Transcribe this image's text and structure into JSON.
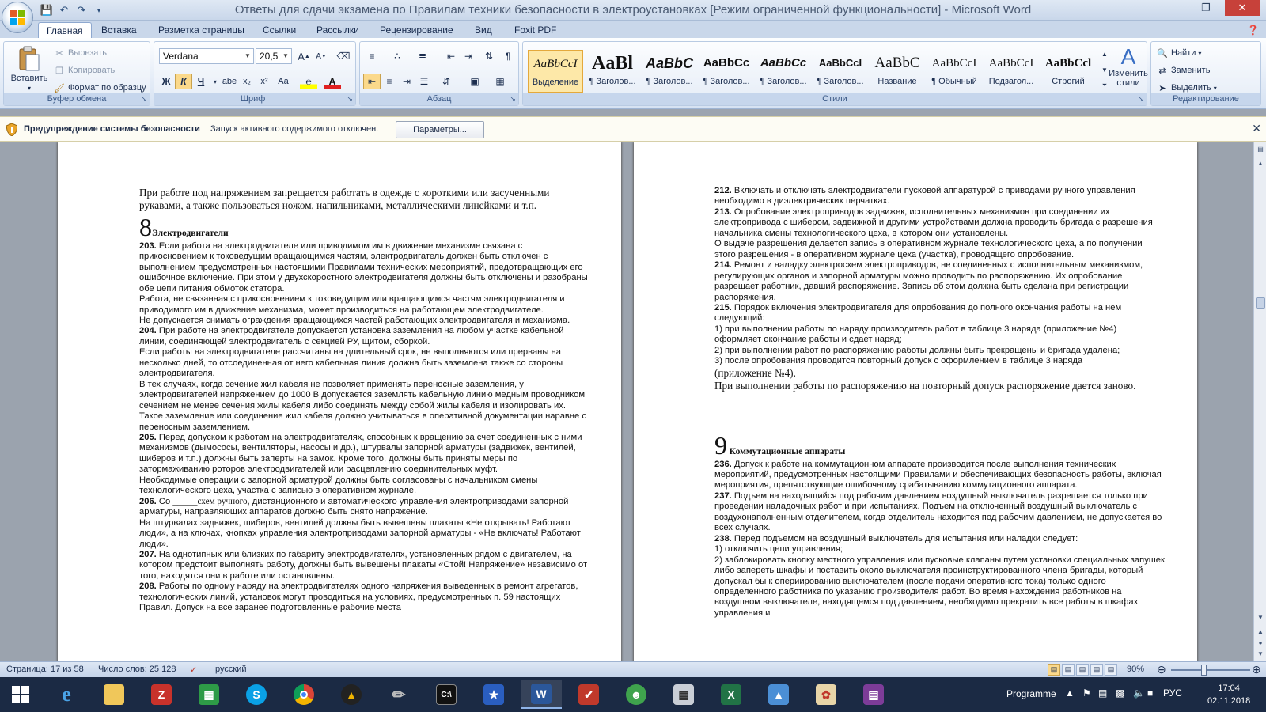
{
  "window": {
    "title": "Ответы для сдачи экзамена по Правилам техники безопасности в электроустановках [Режим ограниченной функциональности] - Microsoft Word"
  },
  "ribbon_tabs": [
    "Главная",
    "Вставка",
    "Разметка страницы",
    "Ссылки",
    "Рассылки",
    "Рецензирование",
    "Вид",
    "Foxit PDF"
  ],
  "clipboard": {
    "paste": "Вставить",
    "cut": "Вырезать",
    "copy": "Копировать",
    "format_painter": "Формат по образцу",
    "label": "Буфер обмена"
  },
  "font": {
    "name": "Verdana",
    "size": "20,5",
    "label": "Шрифт",
    "bold": "Ж",
    "italic": "К",
    "underline": "Ч",
    "strike": "abe",
    "subscript": "x₂",
    "superscript": "x²",
    "change_case": "Aa",
    "grow": "A",
    "shrink": "A"
  },
  "paragraph": {
    "label": "Абзац"
  },
  "styles": {
    "label": "Стили",
    "items": [
      {
        "sample": "AaBbCcI",
        "name": "Выделение"
      },
      {
        "sample": "AaBl",
        "name": "¶ Заголов..."
      },
      {
        "sample": "AaBbC",
        "name": "¶ Заголов..."
      },
      {
        "sample": "AaBbCc",
        "name": "¶ Заголов..."
      },
      {
        "sample": "AaBbCc",
        "name": "¶ Заголов..."
      },
      {
        "sample": "AaBbCcI",
        "name": "¶ Заголов..."
      },
      {
        "sample": "AaBbC",
        "name": "Название"
      },
      {
        "sample": "AaBbCcI",
        "name": "¶ Обычный"
      },
      {
        "sample": "AaBbCcI",
        "name": "Подзагол..."
      },
      {
        "sample": "AaBbCcl",
        "name": "Строгий"
      }
    ],
    "change_styles": "Изменить стили"
  },
  "editing": {
    "label": "Редактирование",
    "find": "Найти",
    "replace": "Заменить",
    "select": "Выделить"
  },
  "security_bar": {
    "title": "Предупреждение системы безопасности",
    "message": "Запуск активного содержимого отключен.",
    "button": "Параметры..."
  },
  "left_page": {
    "intro": "При работе под напряжением запрещается работать в одежде с короткими или засученными рукавами, а также пользоваться ножом, напильниками, металлическими линейками и т.п.",
    "section_num": "8",
    "section_title": "Электродвигатели",
    "p203_num": "203.",
    "p203": "Если работа на электродвигателе или приводимом им в движение механизме связана с прикосновением к токоведущим вращающимся частям, электродвигатель должен быть отключен с выполнением предусмотренных настоящими Правилами технических мероприятий, предотвращающих его ошибочное включение. При этом у двухскоростного электродвигателя должны быть отключены и разобраны обе цепи питания обмоток статора.",
    "p203b": "Работа, не связанная с прикосновением к токоведущим или вращающимся частям электродвигателя и приводимого им в движение механизма, может производиться на работающем электродвигателе.",
    "p203c": "Не допускается снимать ограждения вращающихся частей работающих электродвигателя и механизма.",
    "p204_num": "204.",
    "p204": "При работе на электродвигателе допускается установка заземления на любом участке кабельной линии, соединяющей электродвигатель с секцией РУ, щитом, сборкой.",
    "p204b": "Если работы на электродвигателе рассчитаны на длительный срок, не выполняются или прерваны на несколько дней, то отсоединенная от него кабельная линия должна быть заземлена также со стороны электродвигателя.",
    "p204c": "В тех случаях, когда сечение жил кабеля не позволяет применять переносные заземления, у электродвигателей напряжением до 1000 В допускается заземлять кабельную линию медным проводником сечением не менее сечения жилы кабеля либо соединять между собой жилы кабеля и изолировать их. Такое заземление или соединение жил кабеля должно учитываться в оперативной документации наравне с переносным заземлением.",
    "p205_num": "205.",
    "p205": "Перед допуском к работам на электродвигателях, способных к вращению за счет соединенных с ними механизмов (дымососы, вентиляторы, насосы и др.), штурвалы запорной арматуры (задвижек, вентилей, шиберов и т.п.) должны быть заперты на замок. Кроме того, должны быть приняты меры по затормаживанию роторов электродвигателей или расцеплению соединительных муфт.",
    "p205b": "Необходимые операции с запорной арматурой должны быть согласованы с начальником смены технологического цеха, участка с записью в оперативном журнале.",
    "p206_num": "206.",
    "p206_a": "Со ",
    "p206_blank": "_____",
    "p206_serif": "схем ручного",
    "p206": ", дистанционного и автоматического управления электроприводами запорной арматуры, направляющих аппаратов должно быть снято напряжение.",
    "p206b": "На штурвалах задвижек, шиберов, вентилей должны быть вывешены плакаты «Не открывать! Работают люди», а на ключах, кнопках управления электроприводами запорной арматуры - «Не включать! Работают люди».",
    "p207_num": "207.",
    "p207": "На однотипных или близких по габариту электродвигателях, установленных рядом с двигателем, на котором предстоит выполнять работу, должны быть вывешены плакаты «Стой! Напряжение» независимо от того, находятся они в работе или остановлены.",
    "p208_num": "208.",
    "p208": "Работы по одному наряду на электродвигателях одного напряжения выведенных в ремонт агрегатов, технологических линий, установок могут проводиться на условиях, предусмотренных п. 59 настоящих Правил. Допуск на все заранее подготовленные рабочие места"
  },
  "right_page": {
    "p212_num": "212.",
    "p212": "Включать и отключать электродвигатели пусковой аппаратурой с приводами ручного управления необходимо в диэлектрических перчатках.",
    "p213_num": "213.",
    "p213": "Опробование электроприводов задвижек, исполнительных механизмов при соединении их электропривода с шибером, задвижкой и другими устройствами должна проводить бригада с разрешения начальника смены технологического цеха, в котором они установлены.",
    "p213b": "О выдаче разрешения делается запись в оперативном журнале технологического цеха, а по получении этого разрешения - в оперативном журнале цеха (участка), проводящего опробование.",
    "p214_num": "214.",
    "p214": "Ремонт и наладку электросхем электроприводов, не соединенных с исполнительным механизмом, регулирующих органов и запорной арматуры можно проводить по распоряжению. Их опробование разрешает работник, давший распоряжение. Запись об этом должна быть сделана при регистрации распоряжения.",
    "p215_num": "215.",
    "p215": "Порядок включения электродвигателя для опробования до полного окончания работы на нем следующий:",
    "p215_1": "1) при выполнении работы по наряду производитель работ в таблице 3 наряда (приложение №4) оформляет окончание работы и сдает наряд;",
    "p215_2": "2) при выполнении работ по распоряжению работы должны быть прекращены и бригада удалена;",
    "p215_3": "3) после опробования проводится повторный допуск с оформлением в таблице 3 наряда",
    "p215_3b": "(приложение №4).",
    "p215_end": "При выполнении работы по распоряжению на повторный допуск распоряжение дается заново.",
    "section_num": "9",
    "section_title": "Коммутационные аппараты",
    "p236_num": "236.",
    "p236": "Допуск к работе на коммутационном аппарате производится после выполнения технических мероприятий, предусмотренных настоящими Правилами и обеспечивающих безопасность работы, включая мероприятия, препятствующие ошибочному срабатыванию коммутационного аппарата.",
    "p237_num": "237.",
    "p237": "Подъем на находящийся под рабочим давлением воздушный выключатель разрешается только при проведении наладочных работ и при испытаниях. Подъем на отключенный воздушный выключатель с воздухонаполненным отделителем, когда отделитель находится под рабочим давлением, не допускается во всех случаях.",
    "p238_num": "238.",
    "p238": "Перед подъемом на воздушный выключатель для испытания или наладки следует:",
    "p238_1": "1) отключить цепи управления;",
    "p238_2": "2) заблокировать кнопку местного управления или пусковые клапаны путем установки специальных запушек либо запереть шкафы и поставить около выключателя проинструктированного члена бригады, который допускал бы к опериированию выключателем (после подачи оперативного тока) только одного определенного работника по указанию производителя работ. Во время нахождения работников на воздушном выключателе, находящемся под давлением, необходимо прекратить все работы в шкафах управления и"
  },
  "status_bar": {
    "page": "Страница: 17 из 58",
    "words": "Число слов: 25 128",
    "language": "русский",
    "zoom": "90%"
  },
  "taskbar": {
    "programme": "Programme",
    "lang": "РУС",
    "time": "17:04",
    "date": "02.11.2018"
  }
}
